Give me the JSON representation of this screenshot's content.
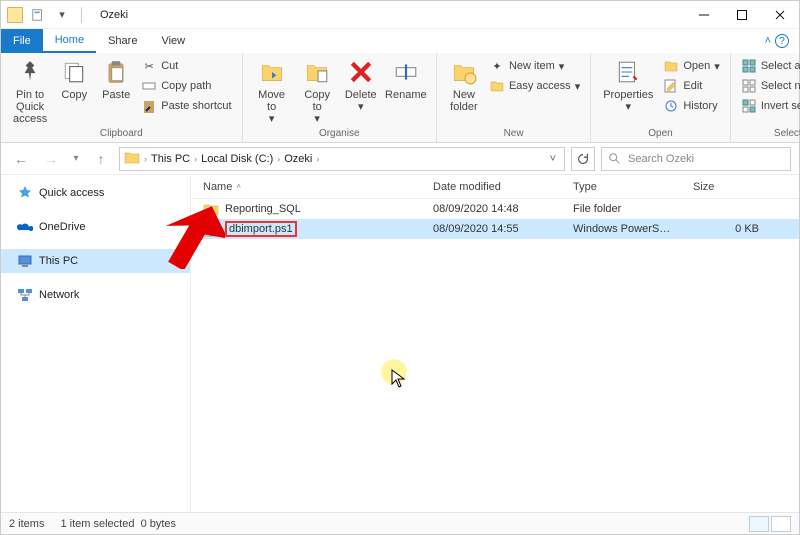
{
  "window": {
    "title": "Ozeki"
  },
  "tabs": {
    "file": "File",
    "home": "Home",
    "share": "Share",
    "view": "View"
  },
  "ribbon": {
    "clipboard": {
      "group": "Clipboard",
      "pin": "Pin to Quick access",
      "copy": "Copy",
      "paste": "Paste",
      "cut": "Cut",
      "copyPath": "Copy path",
      "pasteShortcut": "Paste shortcut"
    },
    "organise": {
      "group": "Organise",
      "moveTo": "Move to",
      "copyTo": "Copy to",
      "delete": "Delete",
      "rename": "Rename"
    },
    "new": {
      "group": "New",
      "newFolder": "New folder",
      "newItem": "New item",
      "easyAccess": "Easy access"
    },
    "open": {
      "group": "Open",
      "properties": "Properties",
      "open": "Open",
      "edit": "Edit",
      "history": "History"
    },
    "select": {
      "group": "Select",
      "all": "Select all",
      "none": "Select none",
      "invert": "Invert selection"
    }
  },
  "breadcrumbs": [
    "This PC",
    "Local Disk (C:)",
    "Ozeki"
  ],
  "search": {
    "placeholder": "Search Ozeki"
  },
  "sidebar": {
    "quick": "Quick access",
    "onedrive": "OneDrive",
    "thispc": "This PC",
    "network": "Network"
  },
  "columns": {
    "name": "Name",
    "date": "Date modified",
    "type": "Type",
    "size": "Size"
  },
  "files": [
    {
      "name": "Reporting_SQL",
      "date": "08/09/2020 14:48",
      "type": "File folder",
      "size": "",
      "kind": "folder",
      "selected": false
    },
    {
      "name": "dbimport.ps1",
      "date": "08/09/2020 14:55",
      "type": "Windows PowerS…",
      "size": "0 KB",
      "kind": "ps1",
      "selected": true
    }
  ],
  "status": {
    "count": "2 items",
    "selection": "1 item selected",
    "bytes": "0 bytes"
  }
}
